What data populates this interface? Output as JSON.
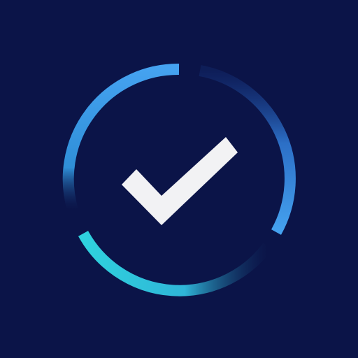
{
  "app_icon": {
    "icon": "circular-progress-check-icon",
    "colors": {
      "background": "#0b1448",
      "ring_blue": "#45a2f0",
      "ring_cyan": "#2fd2de",
      "ring_dark": "#173a8a",
      "checkmark": "#f2f2f4"
    },
    "progress_segments": [
      {
        "name": "top-left",
        "color_from": "#45a2f0",
        "color_to": "#2fa8d2"
      },
      {
        "name": "right",
        "color_from": "#173a8a",
        "color_to": "#45a2f0"
      },
      {
        "name": "bottom",
        "color_from": "#2fd2de",
        "color_to": "#173a8a"
      }
    ]
  }
}
